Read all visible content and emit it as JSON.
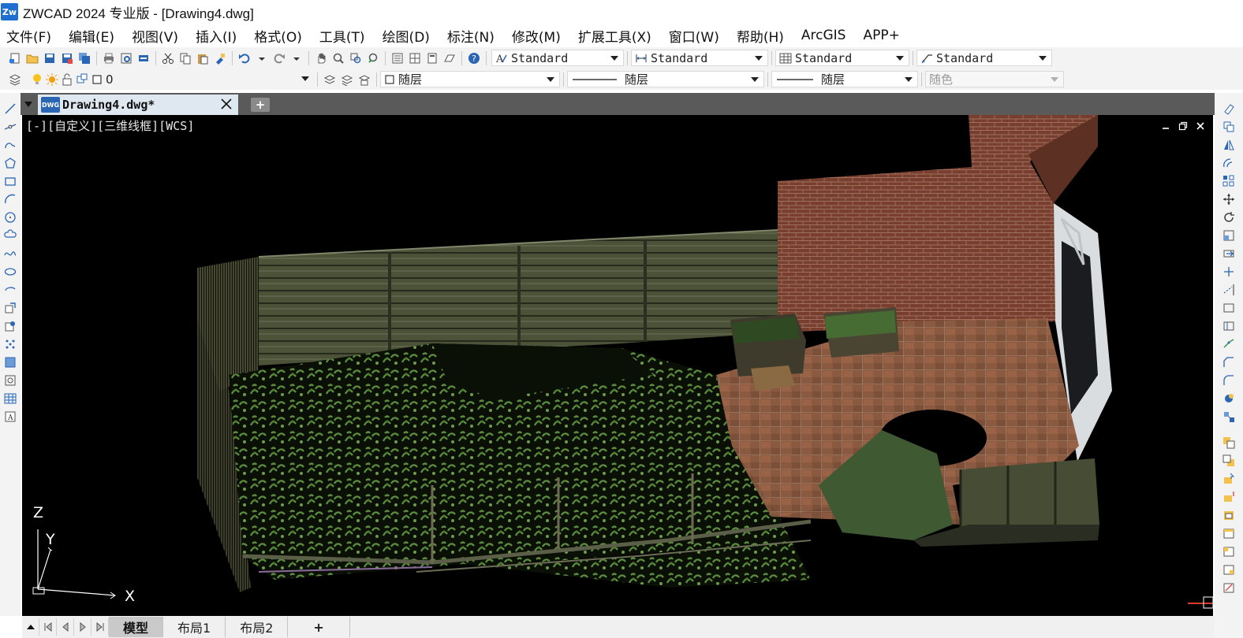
{
  "window": {
    "app_logo_text": "Zw",
    "title": "ZWCAD 2024 专业版 - [Drawing4.dwg]"
  },
  "menu": [
    "文件(F)",
    "编辑(E)",
    "视图(V)",
    "插入(I)",
    "格式(O)",
    "工具(T)",
    "绘图(D)",
    "标注(N)",
    "修改(M)",
    "扩展工具(X)",
    "窗口(W)",
    "帮助(H)",
    "ArcGIS",
    "APP+"
  ],
  "styles": {
    "text_style": "Standard",
    "dim_style": "Standard",
    "table_style": "Standard",
    "mleader_style": "Standard"
  },
  "layer": {
    "current": "0",
    "color": "随层",
    "linetype": "随层",
    "lineweight": "随层",
    "plot_style": "随色"
  },
  "document": {
    "tab_name": "Drawing4.dwg*",
    "tab_icon_text": "DWG",
    "new_tab_glyph": "+"
  },
  "viewport": {
    "label": "[-][自定义][三维线框][WCS]",
    "ucs_axes": {
      "z": "Z",
      "y": "Y",
      "x": "X"
    }
  },
  "layout_tabs": [
    "模型",
    "布局1",
    "布局2",
    "+"
  ],
  "active_layout": "模型",
  "colors": {
    "viewport_bg": "#000000",
    "accent": "#1f6fd0",
    "brick": "#7a3e2e",
    "grass": "#4f7a36",
    "fence": "#5a6345",
    "tiles": "#8a5a40"
  }
}
